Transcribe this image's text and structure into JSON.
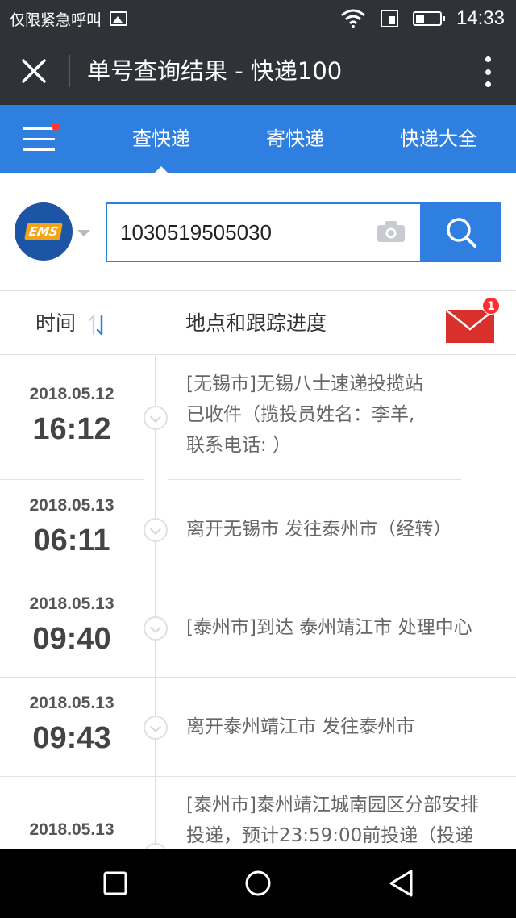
{
  "status_bar": {
    "carrier_text": "仅限紧急呼叫",
    "time": "14:33",
    "icons": [
      "image-icon",
      "wifi-icon",
      "sim-icon",
      "battery-icon"
    ]
  },
  "title_bar": {
    "title": "单号查询结果 - 快递100",
    "close_icon": "close-icon",
    "more_icon": "more-vert-icon"
  },
  "nav": {
    "tabs": [
      {
        "label": "查快递",
        "active": true
      },
      {
        "label": "寄快递",
        "active": false
      },
      {
        "label": "快递大全",
        "active": false
      }
    ],
    "accent": "#2f7fe0"
  },
  "search": {
    "carrier_logo_text": "EMS",
    "tracking_number": "1030519505030"
  },
  "list_header": {
    "time_label": "时间",
    "place_label": "地点和跟踪进度",
    "mail_badge": "1"
  },
  "tracking": [
    {
      "date": "2018.05.12",
      "time": "16:12",
      "lines": [
        "[无锡市]无锡八士速递投揽站",
        "已收件（揽投员姓名：李羊,",
        "联系电话: ）"
      ]
    },
    {
      "date": "2018.05.13",
      "time": "06:11",
      "lines": [
        "离开无锡市 发往泰州市（经转）"
      ]
    },
    {
      "date": "2018.05.13",
      "time": "09:40",
      "lines": [
        "[泰州市]到达 泰州靖江市 处理中心"
      ]
    },
    {
      "date": "2018.05.13",
      "time": "09:43",
      "lines": [
        "离开泰州靖江市 发往泰州市"
      ]
    },
    {
      "date": "2018.05.13",
      "time": "",
      "lines": [
        "[泰州市]泰州靖江城南园区分部安排",
        "投递，预计23:59:00前投递（投递"
      ]
    }
  ]
}
